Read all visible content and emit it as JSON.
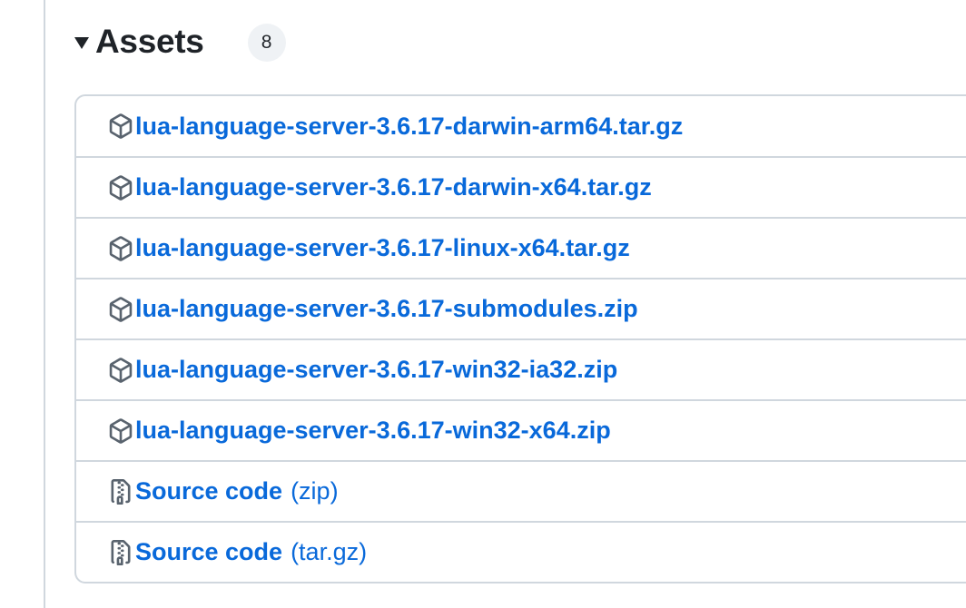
{
  "assets": {
    "title": "Assets",
    "count": "8",
    "items": [
      {
        "icon": "package-icon",
        "label": "lua-language-server-3.6.17-darwin-arm64.tar.gz",
        "suffix": ""
      },
      {
        "icon": "package-icon",
        "label": "lua-language-server-3.6.17-darwin-x64.tar.gz",
        "suffix": ""
      },
      {
        "icon": "package-icon",
        "label": "lua-language-server-3.6.17-linux-x64.tar.gz",
        "suffix": ""
      },
      {
        "icon": "package-icon",
        "label": "lua-language-server-3.6.17-submodules.zip",
        "suffix": ""
      },
      {
        "icon": "package-icon",
        "label": "lua-language-server-3.6.17-win32-ia32.zip",
        "suffix": ""
      },
      {
        "icon": "package-icon",
        "label": "lua-language-server-3.6.17-win32-x64.zip",
        "suffix": ""
      },
      {
        "icon": "file-zip-icon",
        "label": "Source code",
        "suffix": "(zip)"
      },
      {
        "icon": "file-zip-icon",
        "label": "Source code",
        "suffix": "(tar.gz)"
      }
    ]
  },
  "colors": {
    "link": "#0969da",
    "text": "#1f2328",
    "icon": "#59636e",
    "border": "#d0d7de",
    "badge_bg": "#eff2f5"
  }
}
